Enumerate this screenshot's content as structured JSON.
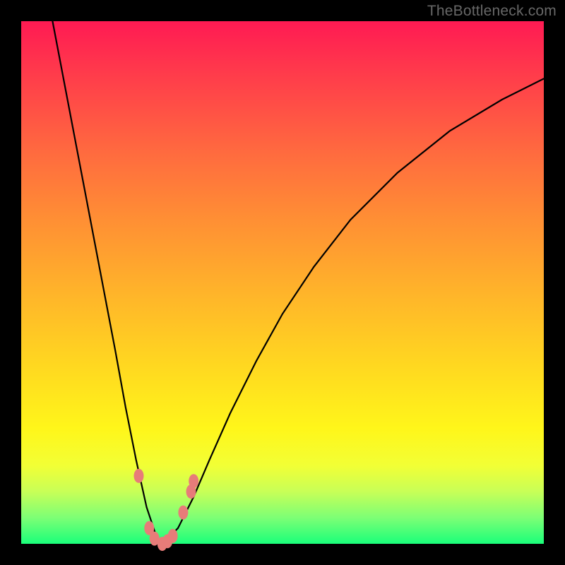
{
  "watermark": "TheBottleneck.com",
  "colors": {
    "frame": "#000000",
    "watermark": "#676767",
    "curve": "#000000",
    "marker": "#e77c79",
    "gradient_top": "#ff1a53",
    "gradient_bottom": "#1aff7a"
  },
  "chart_data": {
    "type": "line",
    "title": "",
    "xlabel": "",
    "ylabel": "",
    "xlim": [
      0,
      100
    ],
    "ylim": [
      0,
      100
    ],
    "grid": false,
    "legend": false,
    "note": "V-shaped bottleneck curve. y is deviation (0 = ideal / green, 100 = worst / red). Optimum at x≈27.",
    "series": [
      {
        "name": "bottleneck-curve",
        "x": [
          6,
          10,
          14,
          18,
          20,
          22,
          24,
          26,
          27,
          28,
          30,
          33,
          36,
          40,
          45,
          50,
          56,
          63,
          72,
          82,
          92,
          100
        ],
        "y": [
          100,
          79,
          58,
          37,
          26,
          16,
          7,
          1,
          0,
          1,
          3,
          9,
          16,
          25,
          35,
          44,
          53,
          62,
          71,
          79,
          85,
          89
        ]
      }
    ],
    "markers": {
      "name": "bottleneck-data-points",
      "note": "small coral dots clustered near the optimum",
      "points": [
        {
          "x": 22.5,
          "y": 13
        },
        {
          "x": 24.5,
          "y": 3
        },
        {
          "x": 25.5,
          "y": 1
        },
        {
          "x": 27.0,
          "y": 0
        },
        {
          "x": 28.0,
          "y": 0.5
        },
        {
          "x": 29.0,
          "y": 1.5
        },
        {
          "x": 31.0,
          "y": 6
        },
        {
          "x": 32.5,
          "y": 10
        },
        {
          "x": 33.0,
          "y": 12
        }
      ]
    }
  }
}
